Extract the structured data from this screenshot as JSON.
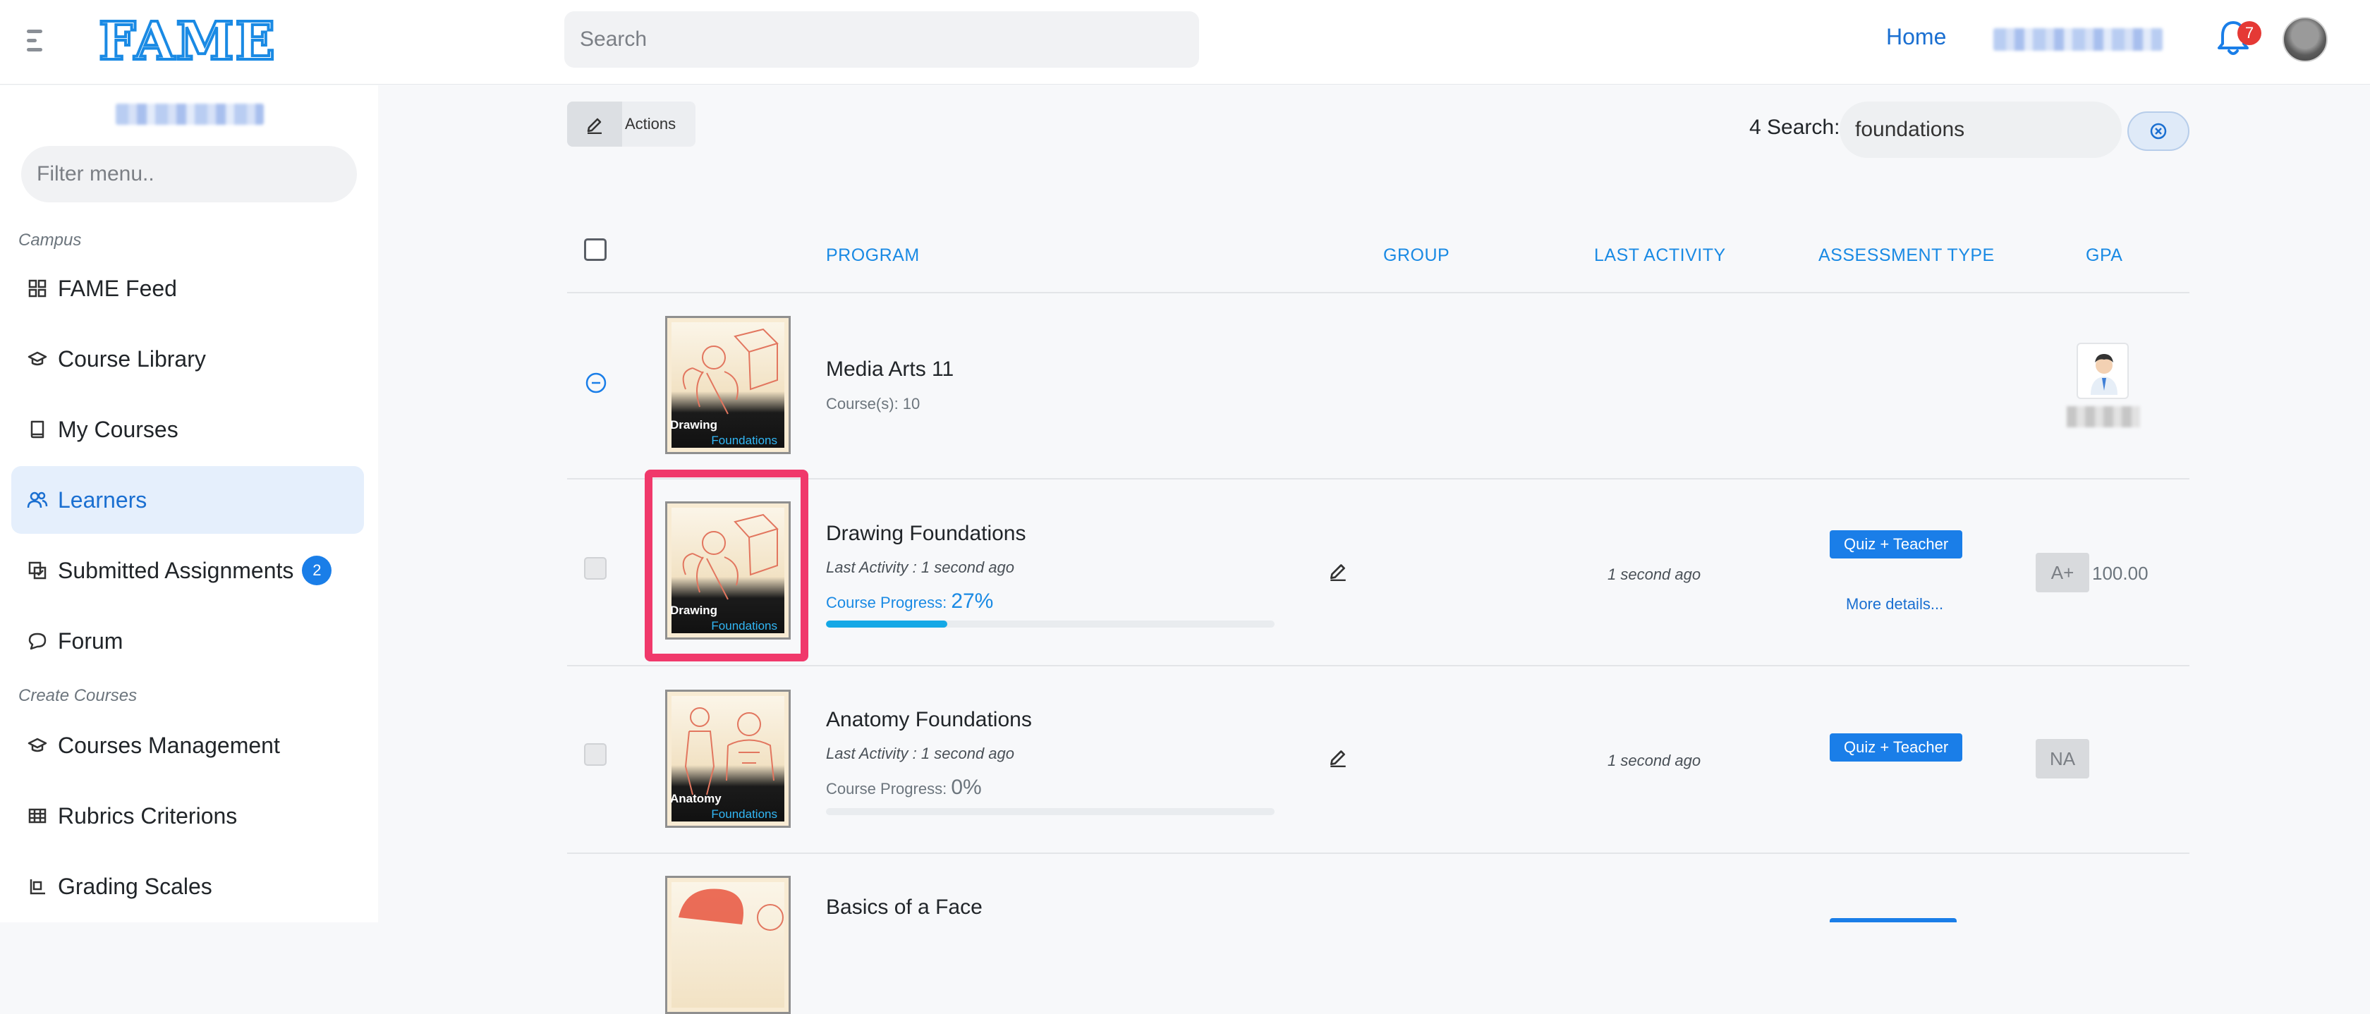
{
  "header": {
    "logo": "FAME",
    "search_placeholder": "Search",
    "home_label": "Home",
    "notification_count": "7"
  },
  "sidebar": {
    "filter_placeholder": "Filter menu..",
    "section_campus": "Campus",
    "section_create": "Create Courses",
    "items": [
      {
        "label": "FAME Feed",
        "icon": "grid-icon"
      },
      {
        "label": "Course Library",
        "icon": "graduation-cap-icon"
      },
      {
        "label": "My Courses",
        "icon": "book-icon"
      },
      {
        "label": "Learners",
        "icon": "users-icon",
        "active": true
      },
      {
        "label": "Submitted Assignments",
        "icon": "assignments-icon",
        "badge": "2"
      },
      {
        "label": "Forum",
        "icon": "chat-bubble-icon"
      },
      {
        "label": "Courses Management",
        "icon": "graduation-cap-icon"
      },
      {
        "label": "Rubrics Criterions",
        "icon": "table-icon"
      },
      {
        "label": "Grading Scales",
        "icon": "scale-icon"
      }
    ]
  },
  "toolbar": {
    "actions_label": "Actions",
    "search_count_label": "4 Search:",
    "search_value": "foundations"
  },
  "table": {
    "headers": [
      "PROGRAM",
      "GROUP",
      "LAST ACTIVITY",
      "ASSESSMENT TYPE",
      "GPA"
    ],
    "program_row": {
      "title": "Media Arts 11",
      "subtitle": "Course(s): 10"
    },
    "rows": [
      {
        "title": "Drawing Foundations",
        "last_activity_line": "Last Activity : 1 second ago",
        "progress_label": "Course Progress:",
        "progress_value": "27%",
        "progress_fraction": 0.27,
        "last_activity": "1 second ago",
        "assessment": "Quiz + Teacher",
        "more_details": "More details...",
        "grade": "A+",
        "gpa": "100.00",
        "thumb_line1": "Drawing",
        "thumb_line2": "Foundations"
      },
      {
        "title": "Anatomy Foundations",
        "last_activity_line": "Last Activity : 1 second ago",
        "progress_label": "Course Progress:",
        "progress_value": "0%",
        "progress_fraction": 0.0,
        "last_activity": "1 second ago",
        "assessment": "Quiz + Teacher",
        "grade": "NA",
        "thumb_line1": "Anatomy",
        "thumb_line2": "Foundations"
      },
      {
        "title": "Basics of a Face"
      }
    ],
    "program_thumb_line1": "Drawing",
    "program_thumb_line2": "Foundations"
  },
  "colors": {
    "accent": "#1a8ae4",
    "highlight": "#f0396b",
    "badge": "#1a7ee8",
    "progress": "#14a8e6"
  }
}
